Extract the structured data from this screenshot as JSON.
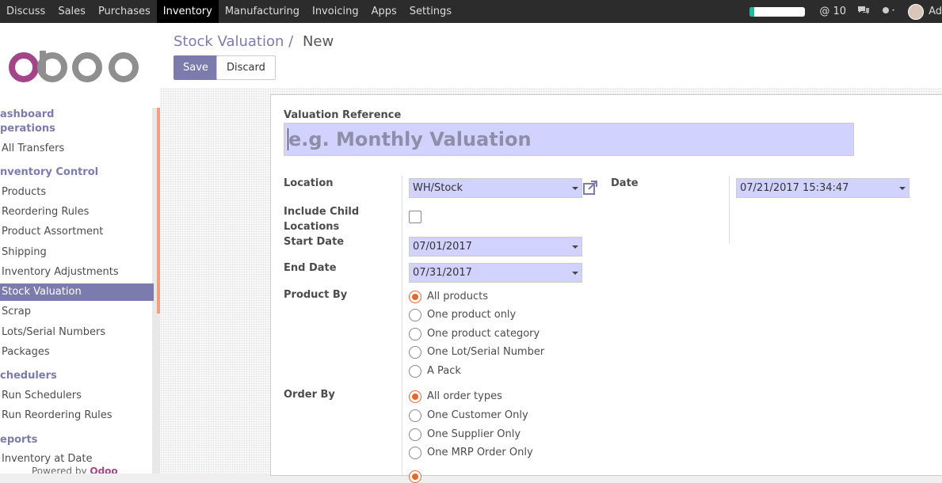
{
  "topbar": {
    "menu": [
      "Discuss",
      "Sales",
      "Purchases",
      "Inventory",
      "Manufacturing",
      "Invoicing",
      "Apps",
      "Settings"
    ],
    "active_menu": "Inventory",
    "messages_count": "@ 10",
    "user_initials": "Ad"
  },
  "sidebar": {
    "sections": [
      {
        "title": "ashboard"
      },
      {
        "title": "perations",
        "items": [
          "All Transfers"
        ]
      },
      {
        "title": "nventory Control",
        "items": [
          "Products",
          "Reordering Rules",
          "Product Assortment",
          "Shipping",
          "Inventory Adjustments",
          "Stock Valuation",
          "Scrap",
          "Lots/Serial Numbers",
          "Packages"
        ]
      },
      {
        "title": "chedulers",
        "items": [
          "Run Schedulers",
          "Run Reordering Rules"
        ]
      },
      {
        "title": "eports",
        "items": [
          "Inventory at Date"
        ]
      }
    ],
    "active_item": "Stock Valuation",
    "powered_by": "Powered by",
    "powered_brand": "Odoo"
  },
  "control": {
    "breadcrumb_parent": "Stock Valuation",
    "breadcrumb_sep": "/",
    "breadcrumb_current": "New",
    "save_label": "Save",
    "discard_label": "Discard"
  },
  "form": {
    "ref_label": "Valuation Reference",
    "ref_placeholder": "e.g. Monthly Valuation",
    "location_label": "Location",
    "location_value": "WH/Stock",
    "date_label": "Date",
    "date_value": "07/21/2017 15:34:47",
    "include_child_label_1": "Include Child",
    "include_child_label_2": "Locations",
    "start_date_label": "Start Date",
    "start_date_value": "07/01/2017",
    "end_date_label": "End Date",
    "end_date_value": "07/31/2017",
    "product_by_label": "Product By",
    "product_by_options": [
      "All products",
      "One product only",
      "One product category",
      "One Lot/Serial Number",
      "A Pack"
    ],
    "order_by_label": "Order By",
    "order_by_options": [
      "All order types",
      "One Customer Only",
      "One Supplier Only",
      "One MRP Order Only"
    ]
  },
  "colors": {
    "brand": "#7c7bad",
    "input_bg": "#d2d2ff",
    "radio_active": "#e8672c"
  }
}
